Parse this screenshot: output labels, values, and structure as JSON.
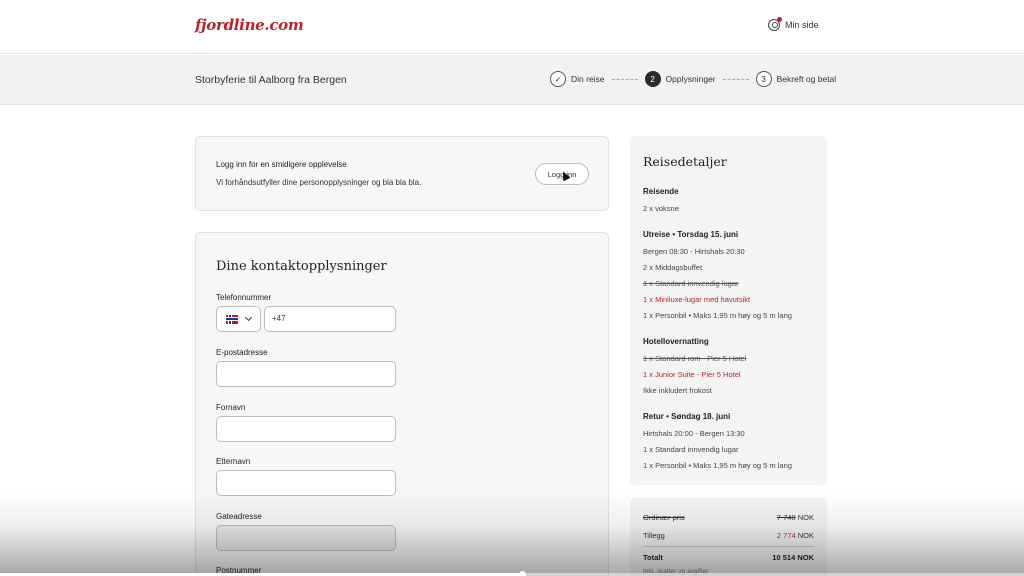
{
  "header": {
    "logo": "fjordline.com",
    "my_page": "Min side"
  },
  "stepbar": {
    "trip_title": "Storbyferie til Aalborg fra Bergen",
    "steps": [
      {
        "number": "✓",
        "label": "Din reise",
        "state": "done"
      },
      {
        "number": "2",
        "label": "Opplysninger",
        "state": "active"
      },
      {
        "number": "3",
        "label": "Bekreft og betal",
        "state": "upcoming"
      }
    ]
  },
  "login": {
    "title": "Logg inn for en smidigere opplevelse",
    "text": "Vi forhåndsutfyller dine personopplysninger og bla bla bla.",
    "button": "Logg inn"
  },
  "contact": {
    "title": "Dine kontaktopplysninger",
    "phone_label": "Telefonnummer",
    "phone_prefix": "+47",
    "email_label": "E-postadresse",
    "firstname_label": "Fornavn",
    "lastname_label": "Etternavn",
    "street_label": "Gateadresse",
    "postal_label": "Postnummer"
  },
  "details": {
    "title": "Reisedetaljer",
    "travelers_head": "Reisende",
    "travelers": "2 x voksne",
    "outbound_head": "Utreise • Torsdag 15. juni",
    "outbound_route": "Bergen 08:30 - Hirtshals 20:30",
    "outbound_meal": "2 x Middagsbuffet",
    "outbound_cabin_old": "1 x Standard innvendig lugar",
    "outbound_cabin_new": "1 x Miniluxe-lugar med havutsikt",
    "outbound_car": "1 x Personbil • Maks 1,95 m høy og 5 m lang",
    "hotel_head": "Hotellovernatting",
    "hotel_old": "1 x Standard rom - Pier 5 Hotel",
    "hotel_new": "1 x Junior Suite - Pier 5 Hotel",
    "hotel_note": "Ikke inkludert frokost",
    "return_head": "Retur • Søndag 18. juni",
    "return_route": "Hirtshals 20:00 - Bergen 13:30",
    "return_cabin": "1 x Standard innvendig lugar",
    "return_car": "1 x Personbil • Maks 1,95 m høy og 5 m lang"
  },
  "pricing": {
    "ordinary_label": "Ordinær pris",
    "ordinary_value": "7 740",
    "extra_label": "Tillegg",
    "extra_value": "2 774",
    "total_label": "Totalt",
    "total_value": "10 514 NOK",
    "currency": "NOK",
    "note": "Inkl. skatter og avgifter"
  },
  "video": {
    "progress_fraction": 0.51
  }
}
